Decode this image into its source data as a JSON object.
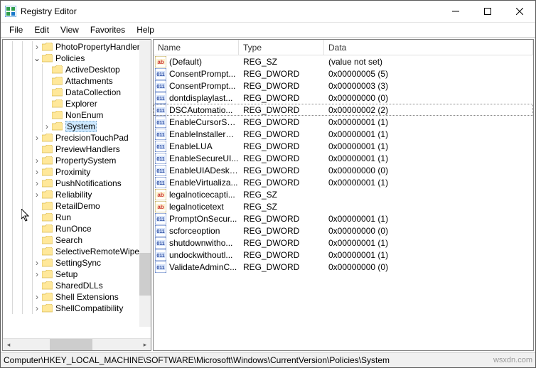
{
  "window": {
    "title": "Registry Editor"
  },
  "menu": {
    "file": "File",
    "edit": "Edit",
    "view": "View",
    "favorites": "Favorites",
    "help": "Help"
  },
  "tree": {
    "items": [
      {
        "indent": 3,
        "label": "PhotoPropertyHandler",
        "expander": "closed"
      },
      {
        "indent": 3,
        "label": "Policies",
        "expander": "open"
      },
      {
        "indent": 4,
        "label": "ActiveDesktop",
        "expander": "none"
      },
      {
        "indent": 4,
        "label": "Attachments",
        "expander": "none"
      },
      {
        "indent": 4,
        "label": "DataCollection",
        "expander": "none"
      },
      {
        "indent": 4,
        "label": "Explorer",
        "expander": "none"
      },
      {
        "indent": 4,
        "label": "NonEnum",
        "expander": "none"
      },
      {
        "indent": 4,
        "label": "System",
        "expander": "closed",
        "selected": true
      },
      {
        "indent": 3,
        "label": "PrecisionTouchPad",
        "expander": "closed"
      },
      {
        "indent": 3,
        "label": "PreviewHandlers",
        "expander": "none"
      },
      {
        "indent": 3,
        "label": "PropertySystem",
        "expander": "closed"
      },
      {
        "indent": 3,
        "label": "Proximity",
        "expander": "closed"
      },
      {
        "indent": 3,
        "label": "PushNotifications",
        "expander": "closed"
      },
      {
        "indent": 3,
        "label": "Reliability",
        "expander": "closed"
      },
      {
        "indent": 3,
        "label": "RetailDemo",
        "expander": "none"
      },
      {
        "indent": 3,
        "label": "Run",
        "expander": "none"
      },
      {
        "indent": 3,
        "label": "RunOnce",
        "expander": "none"
      },
      {
        "indent": 3,
        "label": "Search",
        "expander": "none"
      },
      {
        "indent": 3,
        "label": "SelectiveRemoteWipe",
        "expander": "none"
      },
      {
        "indent": 3,
        "label": "SettingSync",
        "expander": "closed"
      },
      {
        "indent": 3,
        "label": "Setup",
        "expander": "closed"
      },
      {
        "indent": 3,
        "label": "SharedDLLs",
        "expander": "none"
      },
      {
        "indent": 3,
        "label": "Shell Extensions",
        "expander": "closed"
      },
      {
        "indent": 3,
        "label": "ShellCompatibility",
        "expander": "closed"
      }
    ]
  },
  "columns": {
    "name": "Name",
    "type": "Type",
    "data": "Data"
  },
  "values": [
    {
      "icon": "sz",
      "name": "(Default)",
      "type": "REG_SZ",
      "data": "(value not set)"
    },
    {
      "icon": "dw",
      "name": "ConsentPrompt...",
      "type": "REG_DWORD",
      "data": "0x00000005 (5)"
    },
    {
      "icon": "dw",
      "name": "ConsentPrompt...",
      "type": "REG_DWORD",
      "data": "0x00000003 (3)"
    },
    {
      "icon": "dw",
      "name": "dontdisplaylast...",
      "type": "REG_DWORD",
      "data": "0x00000000 (0)"
    },
    {
      "icon": "dw",
      "name": "DSCAutomatio...",
      "type": "REG_DWORD",
      "data": "0x00000002 (2)",
      "selected": true
    },
    {
      "icon": "dw",
      "name": "EnableCursorSu...",
      "type": "REG_DWORD",
      "data": "0x00000001 (1)"
    },
    {
      "icon": "dw",
      "name": "EnableInstallerD...",
      "type": "REG_DWORD",
      "data": "0x00000001 (1)"
    },
    {
      "icon": "dw",
      "name": "EnableLUA",
      "type": "REG_DWORD",
      "data": "0x00000001 (1)"
    },
    {
      "icon": "dw",
      "name": "EnableSecureUI...",
      "type": "REG_DWORD",
      "data": "0x00000001 (1)"
    },
    {
      "icon": "dw",
      "name": "EnableUIADeskt...",
      "type": "REG_DWORD",
      "data": "0x00000000 (0)"
    },
    {
      "icon": "dw",
      "name": "EnableVirtualiza...",
      "type": "REG_DWORD",
      "data": "0x00000001 (1)"
    },
    {
      "icon": "sz",
      "name": "legalnoticecapti...",
      "type": "REG_SZ",
      "data": ""
    },
    {
      "icon": "sz",
      "name": "legalnoticetext",
      "type": "REG_SZ",
      "data": ""
    },
    {
      "icon": "dw",
      "name": "PromptOnSecur...",
      "type": "REG_DWORD",
      "data": "0x00000001 (1)"
    },
    {
      "icon": "dw",
      "name": "scforceoption",
      "type": "REG_DWORD",
      "data": "0x00000000 (0)"
    },
    {
      "icon": "dw",
      "name": "shutdownwitho...",
      "type": "REG_DWORD",
      "data": "0x00000001 (1)"
    },
    {
      "icon": "dw",
      "name": "undockwithoutl...",
      "type": "REG_DWORD",
      "data": "0x00000001 (1)"
    },
    {
      "icon": "dw",
      "name": "ValidateAdminC...",
      "type": "REG_DWORD",
      "data": "0x00000000 (0)"
    }
  ],
  "status": {
    "path": "Computer\\HKEY_LOCAL_MACHINE\\SOFTWARE\\Microsoft\\Windows\\CurrentVersion\\Policies\\System",
    "watermark": "wsxdn.com"
  }
}
